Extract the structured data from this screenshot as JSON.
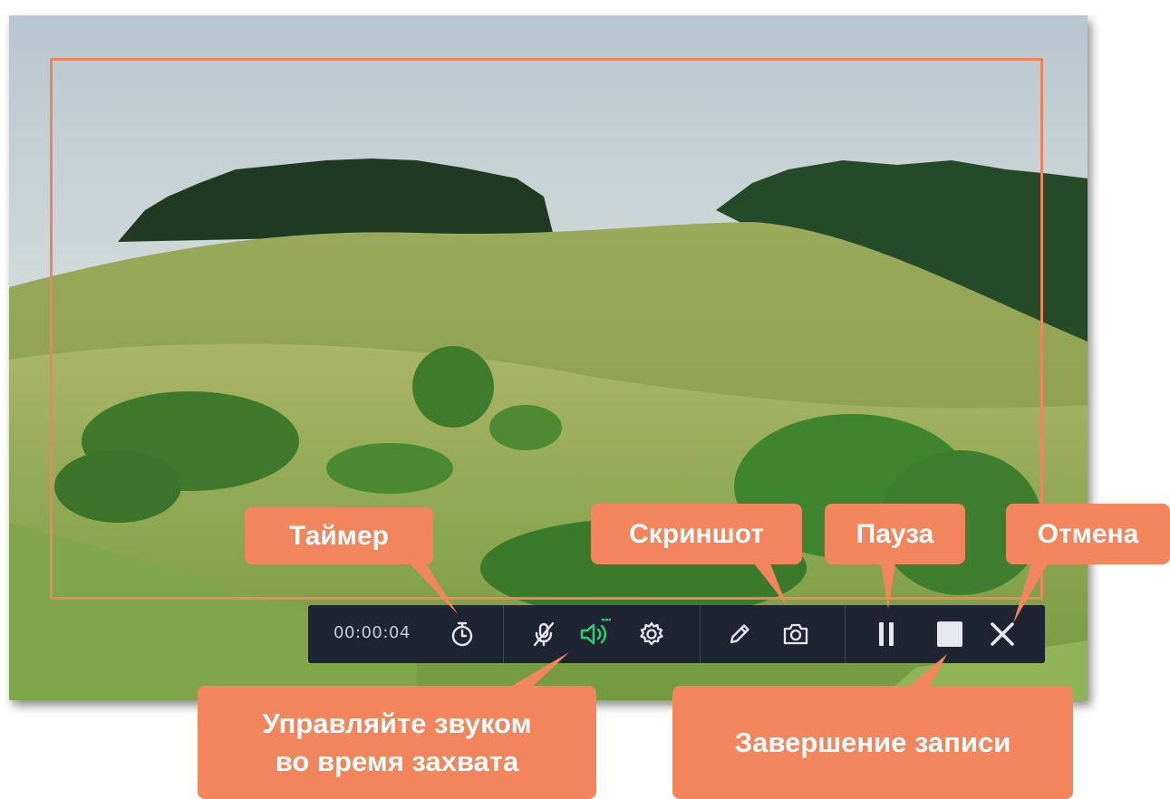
{
  "toolbar": {
    "timer_value": "00:00:04",
    "icons": [
      "stopwatch-icon",
      "microphone-muted-icon",
      "speaker-icon",
      "gear-icon",
      "pencil-icon",
      "camera-icon",
      "pause-icon",
      "stop-icon",
      "close-icon"
    ],
    "speaker_color": "#2ecc71"
  },
  "callouts": {
    "timer": "Таймер",
    "screenshot": "Скриншот",
    "pause": "Пауза",
    "cancel": "Отмена",
    "sound_line1": "Управляйте звуком",
    "sound_line2": "во время захвата",
    "finish": "Завершение записи"
  },
  "colors": {
    "accent": "#f3855d",
    "toolbar_bg": "#1f2433"
  }
}
